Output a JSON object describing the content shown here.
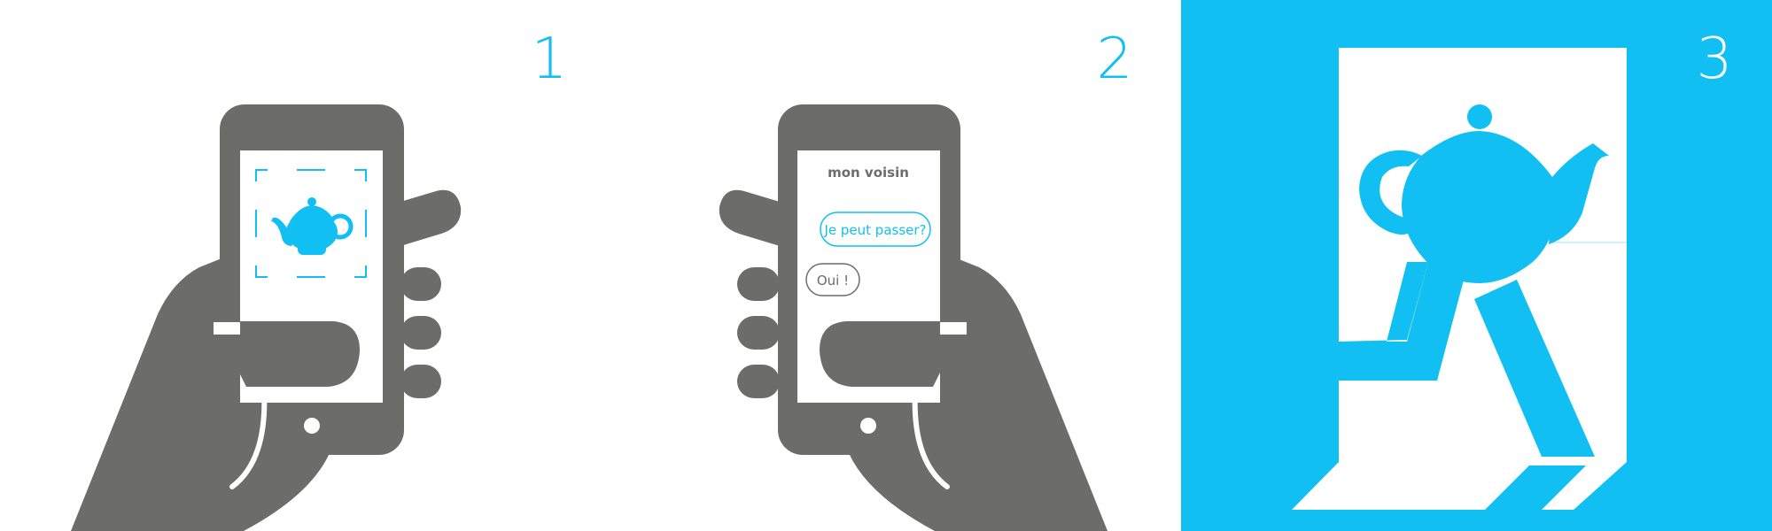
{
  "colors": {
    "accent": "#12bff2",
    "hand": "#6c6c6b",
    "background": "#ffffff"
  },
  "steps": [
    {
      "number": "1",
      "icon": "hand-phone-scan-teapot-icon"
    },
    {
      "number": "2",
      "icon": "hand-phone-chat-icon"
    },
    {
      "number": "3",
      "icon": "teapot-walking-through-door-icon"
    }
  ],
  "chat": {
    "title": "mon voisin",
    "message_sent": "Je peut passer?",
    "message_reply": "Oui !"
  }
}
